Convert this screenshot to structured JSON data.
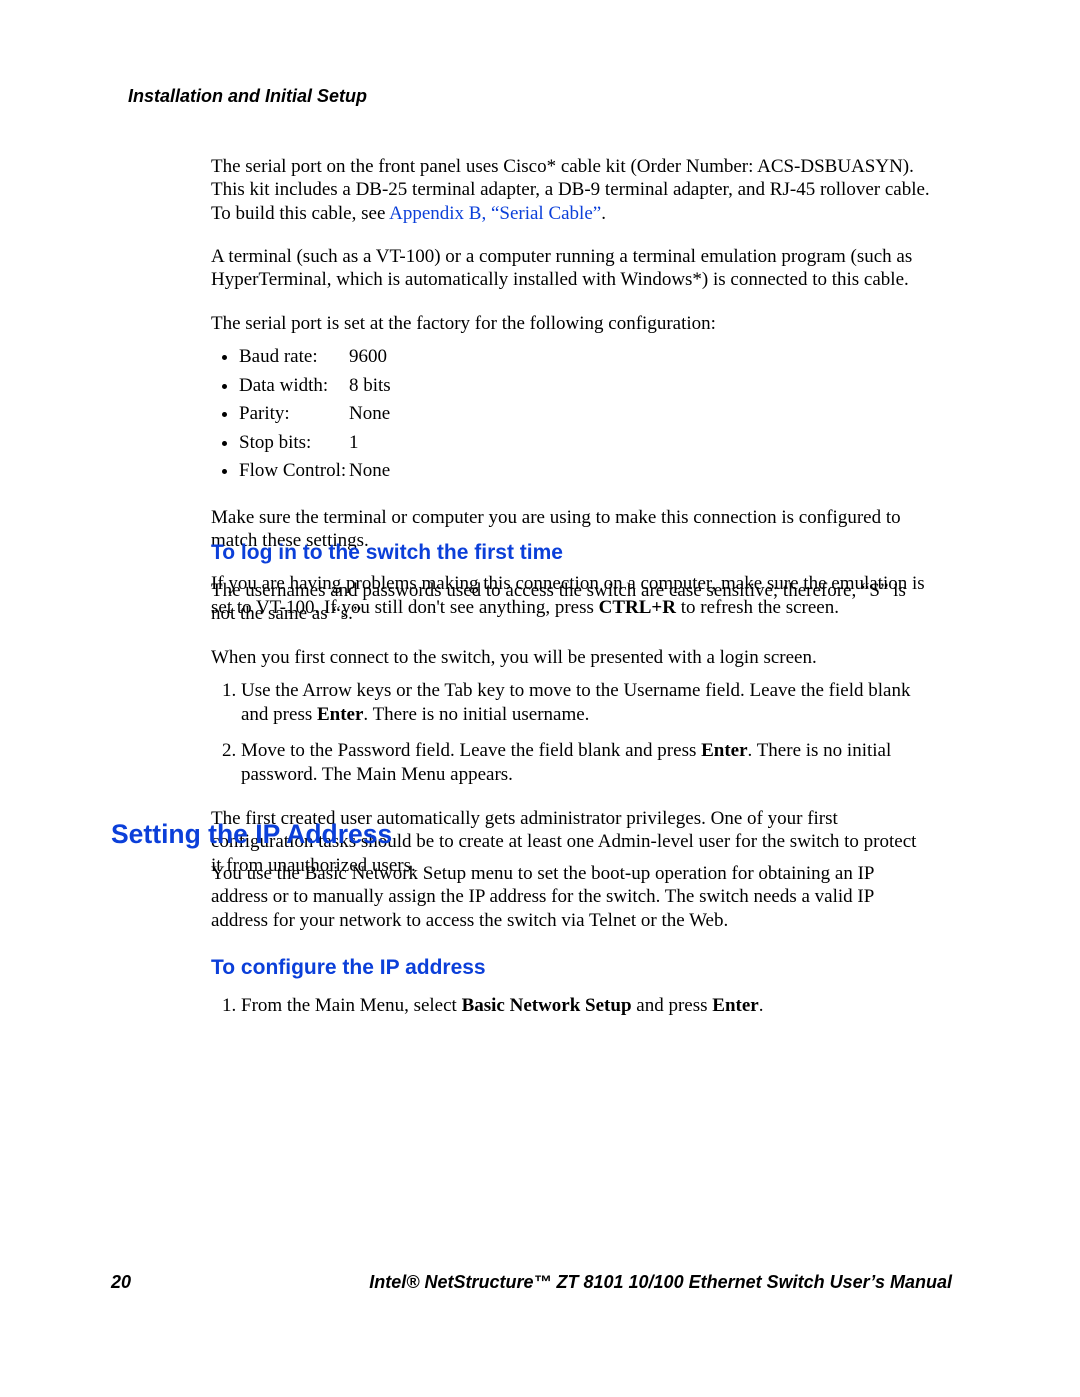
{
  "header": {
    "running_head": "Installation and Initial Setup"
  },
  "intro": {
    "p1_a": "The serial port on the front panel uses Cisco* cable kit (Order Number: ACS-DSBUASYN). This kit includes a DB-25 terminal adapter, a DB-9 terminal adapter, and RJ-45 rollover cable. To build this cable, see ",
    "p1_link": "Appendix B, “Serial Cable”",
    "p1_b": ".",
    "p2": "A terminal (such as a VT-100) or a computer running a terminal emulation program (such as HyperTerminal, which is automatically installed with Windows*) is connected to this cable.",
    "p3": "The serial port is set at the factory for the following configuration:"
  },
  "serial_config": [
    {
      "key": "Baud rate:",
      "value": "9600"
    },
    {
      "key": "Data width:",
      "value": "8 bits"
    },
    {
      "key": "Parity:",
      "value": "None"
    },
    {
      "key": "Stop bits:",
      "value": "1"
    },
    {
      "key": "Flow Control:",
      "value": "None"
    }
  ],
  "after_list": {
    "p4": "Make sure the terminal or computer you are using to make this connection is configured to match these settings.",
    "p5_a": "If you are having problems making this connection on a computer, make sure the emulation is set to VT-100. If you still don't see anything, press ",
    "p5_bold": "CTRL+R",
    "p5_b": " to refresh the screen."
  },
  "login": {
    "heading": "To log in to the switch the first time",
    "p1": "The usernames and passwords used to access the switch are case sensitive; therefore, “S” is not the same as “s.”",
    "p2": "When you first connect to the switch, you will be presented with a login screen.",
    "step1_a": "Use the Arrow keys or the Tab key to move to the Username field. Leave the field blank and press ",
    "step1_bold": "Enter",
    "step1_b": ". There is no initial username.",
    "step2_a": "Move to the Password field. Leave the field blank and press ",
    "step2_bold": "Enter",
    "step2_b": ". There is no initial password. The Main Menu appears.",
    "p3": "The first created user automatically gets administrator privileges. One of your first configuration tasks should be to create at least one Admin-level user for the switch to protect it from unauthorized users."
  },
  "ip": {
    "heading": "Setting the IP Address",
    "p1": "You use the Basic Network Setup menu to set the boot-up operation for obtaining an IP address or to manually assign the IP address for the switch. The switch needs a valid IP address for your network to access the switch via Telnet or the Web.",
    "sub_heading": "To configure the IP address",
    "step1_a": "From the Main Menu, select ",
    "step1_bold1": "Basic Network Setup",
    "step1_mid": " and press ",
    "step1_bold2": "Enter",
    "step1_b": "."
  },
  "footer": {
    "page": "20",
    "title": "Intel® NetStructure™  ZT 8101 10/100 Ethernet Switch User’s Manual"
  }
}
